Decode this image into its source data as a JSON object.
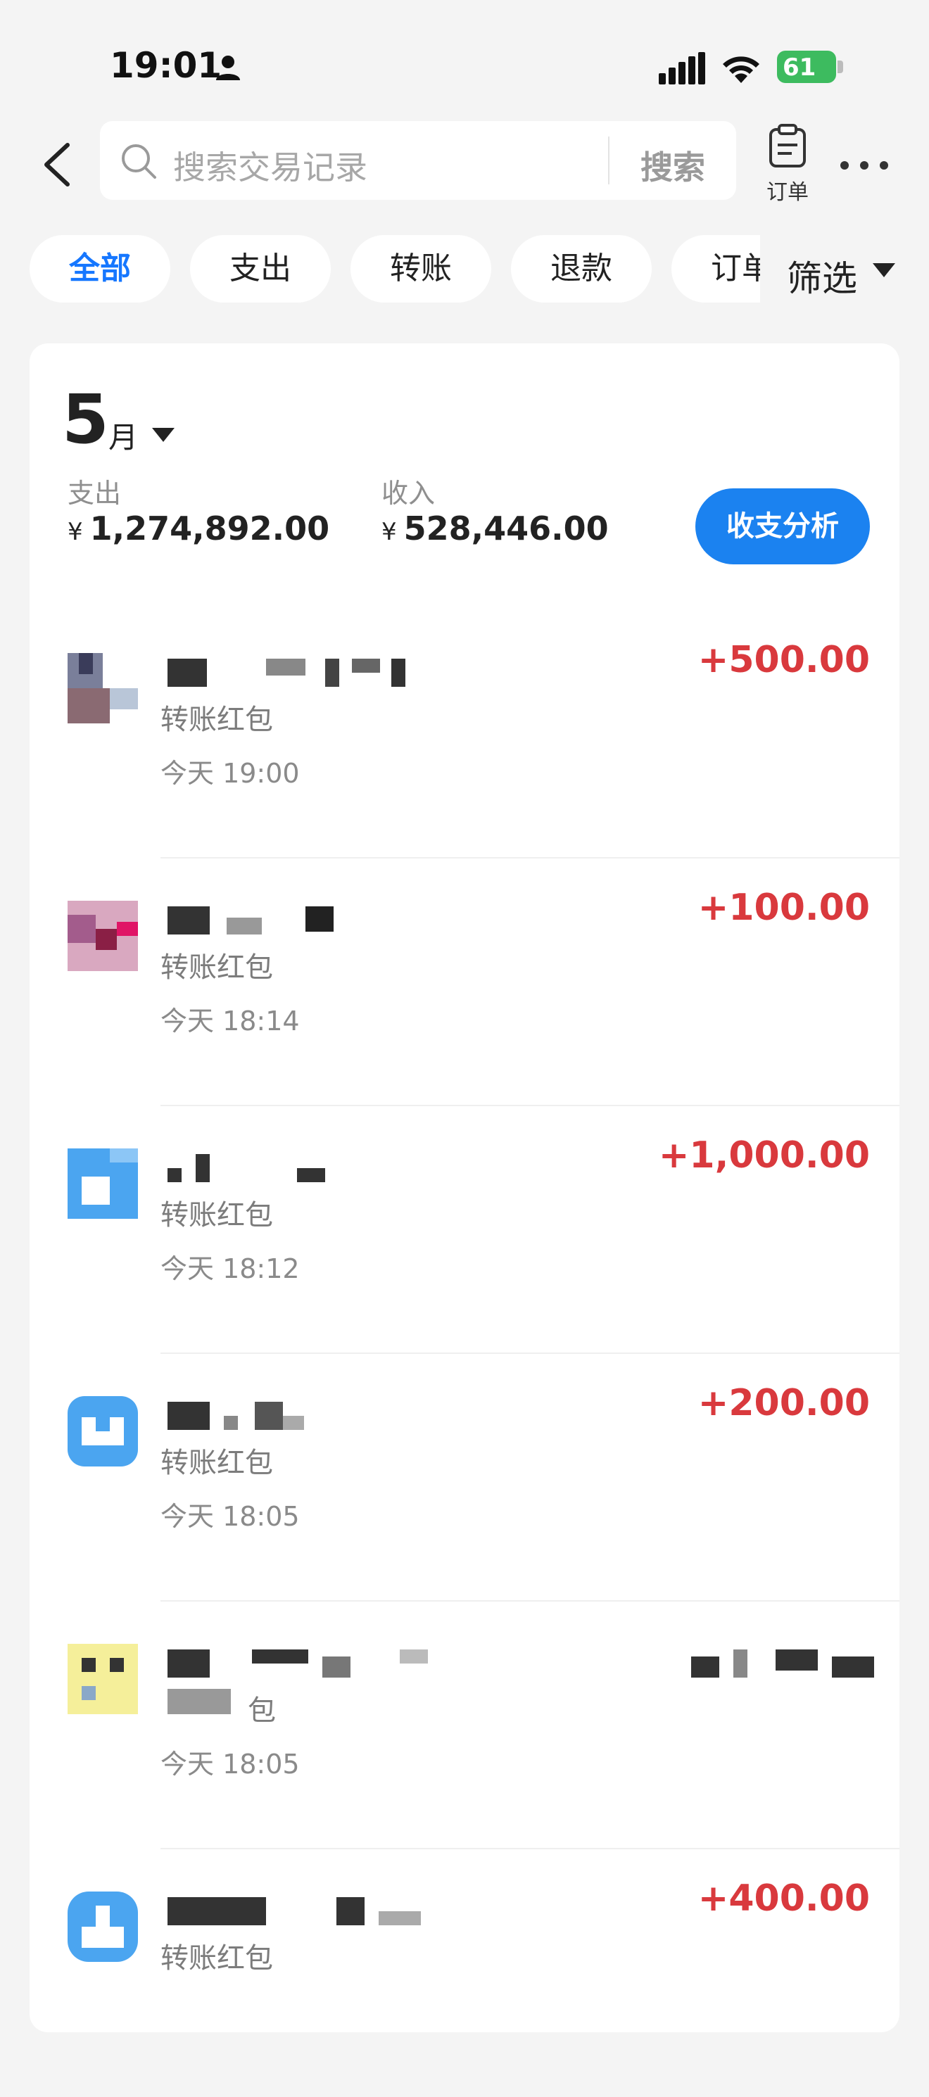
{
  "status_bar": {
    "time": "19:01",
    "battery": "61"
  },
  "search": {
    "placeholder": "搜索交易记录",
    "button": "搜索"
  },
  "header": {
    "order_label": "订单",
    "back_icon": "chevron-left-icon",
    "more_icon": "ellipsis-icon",
    "order_icon": "clipboard-icon"
  },
  "tabs": [
    {
      "label": "全部",
      "active": true
    },
    {
      "label": "支出",
      "active": false
    },
    {
      "label": "转账",
      "active": false
    },
    {
      "label": "退款",
      "active": false
    },
    {
      "label": "订单",
      "active": false
    }
  ],
  "filter": {
    "label": "筛选"
  },
  "summary": {
    "month": "5",
    "month_unit": "月",
    "expense_label": "支出",
    "expense_value": "1,274,892.00",
    "income_label": "收入",
    "income_value": "528,446.00",
    "currency": "¥",
    "analysis_button": "收支分析"
  },
  "transactions": [
    {
      "title": "转账红包",
      "time": "今天 19:00",
      "amount": "+500.00"
    },
    {
      "title": "转账红包",
      "time": "今天 18:14",
      "amount": "+100.00"
    },
    {
      "title": "转账红包",
      "time": "今天 18:12",
      "amount": "+1,000.00"
    },
    {
      "title": "转账红包",
      "time": "今天 18:05",
      "amount": "+200.00"
    },
    {
      "title": "包",
      "time": "今天 18:05",
      "amount": ""
    },
    {
      "title": "转账红包",
      "time": "",
      "amount": "+400.00"
    }
  ],
  "colors": {
    "accent": "#1677ff",
    "income": "#d9393d",
    "battery": "#3dbb5f"
  }
}
